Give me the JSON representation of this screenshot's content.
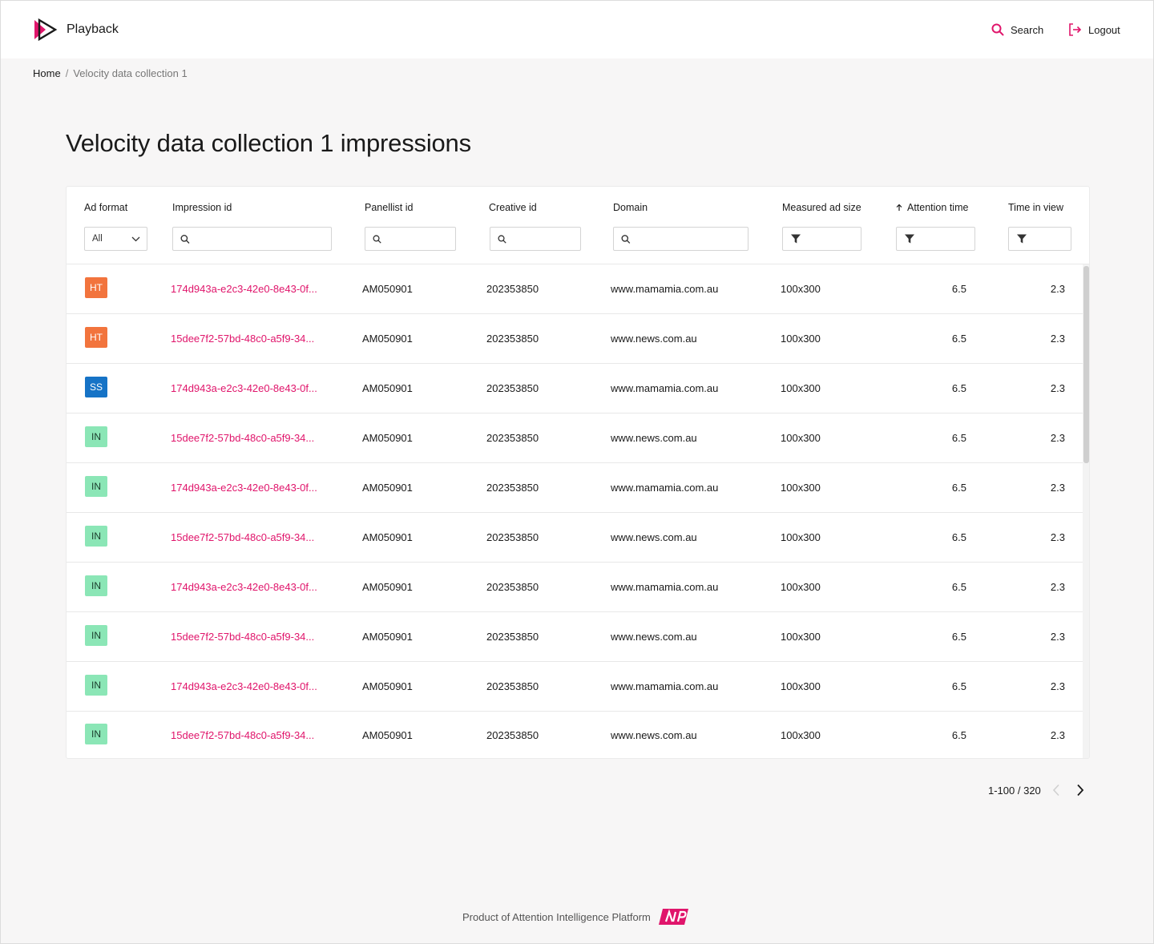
{
  "header": {
    "app_name": "Playback",
    "search_label": "Search",
    "logout_label": "Logout",
    "accent_color": "#e0156b"
  },
  "breadcrumb": {
    "home": "Home",
    "separator": "/",
    "current": "Velocity data collection 1"
  },
  "page": {
    "title": "Velocity data collection 1 impressions"
  },
  "table": {
    "columns": [
      {
        "label": "Ad format",
        "filter": "select",
        "value": "All"
      },
      {
        "label": "Impression id",
        "filter": "search"
      },
      {
        "label": "Panellist id",
        "filter": "search"
      },
      {
        "label": "Creative id",
        "filter": "search"
      },
      {
        "label": "Domain",
        "filter": "search"
      },
      {
        "label": "Measured ad size",
        "filter": "filter"
      },
      {
        "label": "Attention time",
        "filter": "filter",
        "sort": "ascending"
      },
      {
        "label": "Time in view",
        "filter": "filter"
      }
    ],
    "rows": [
      {
        "format": "HT",
        "impression_id": "174d943a-e2c3-42e0-8e43-0f...",
        "panellist_id": "AM050901",
        "creative_id": "202353850",
        "domain": "www.mamamia.com.au",
        "ad_size": "100x300",
        "attention_time": "6.5",
        "time_in_view": "2.3"
      },
      {
        "format": "HT",
        "impression_id": "15dee7f2-57bd-48c0-a5f9-34...",
        "panellist_id": "AM050901",
        "creative_id": "202353850",
        "domain": "www.news.com.au",
        "ad_size": "100x300",
        "attention_time": "6.5",
        "time_in_view": "2.3"
      },
      {
        "format": "SS",
        "impression_id": "174d943a-e2c3-42e0-8e43-0f...",
        "panellist_id": "AM050901",
        "creative_id": "202353850",
        "domain": "www.mamamia.com.au",
        "ad_size": "100x300",
        "attention_time": "6.5",
        "time_in_view": "2.3"
      },
      {
        "format": "IN",
        "impression_id": "15dee7f2-57bd-48c0-a5f9-34...",
        "panellist_id": "AM050901",
        "creative_id": "202353850",
        "domain": "www.news.com.au",
        "ad_size": "100x300",
        "attention_time": "6.5",
        "time_in_view": "2.3"
      },
      {
        "format": "IN",
        "impression_id": "174d943a-e2c3-42e0-8e43-0f...",
        "panellist_id": "AM050901",
        "creative_id": "202353850",
        "domain": "www.mamamia.com.au",
        "ad_size": "100x300",
        "attention_time": "6.5",
        "time_in_view": "2.3"
      },
      {
        "format": "IN",
        "impression_id": "15dee7f2-57bd-48c0-a5f9-34...",
        "panellist_id": "AM050901",
        "creative_id": "202353850",
        "domain": "www.news.com.au",
        "ad_size": "100x300",
        "attention_time": "6.5",
        "time_in_view": "2.3"
      },
      {
        "format": "IN",
        "impression_id": "174d943a-e2c3-42e0-8e43-0f...",
        "panellist_id": "AM050901",
        "creative_id": "202353850",
        "domain": "www.mamamia.com.au",
        "ad_size": "100x300",
        "attention_time": "6.5",
        "time_in_view": "2.3"
      },
      {
        "format": "IN",
        "impression_id": "15dee7f2-57bd-48c0-a5f9-34...",
        "panellist_id": "AM050901",
        "creative_id": "202353850",
        "domain": "www.news.com.au",
        "ad_size": "100x300",
        "attention_time": "6.5",
        "time_in_view": "2.3"
      },
      {
        "format": "IN",
        "impression_id": "174d943a-e2c3-42e0-8e43-0f...",
        "panellist_id": "AM050901",
        "creative_id": "202353850",
        "domain": "www.mamamia.com.au",
        "ad_size": "100x300",
        "attention_time": "6.5",
        "time_in_view": "2.3"
      },
      {
        "format": "IN",
        "impression_id": "15dee7f2-57bd-48c0-a5f9-34...",
        "panellist_id": "AM050901",
        "creative_id": "202353850",
        "domain": "www.news.com.au",
        "ad_size": "100x300",
        "attention_time": "6.5",
        "time_in_view": "2.3"
      }
    ]
  },
  "pagination": {
    "range_label": "1-100 / 320"
  },
  "footer": {
    "text": "Product of Attention Intelligence Platform",
    "logo_text": "AIP"
  }
}
